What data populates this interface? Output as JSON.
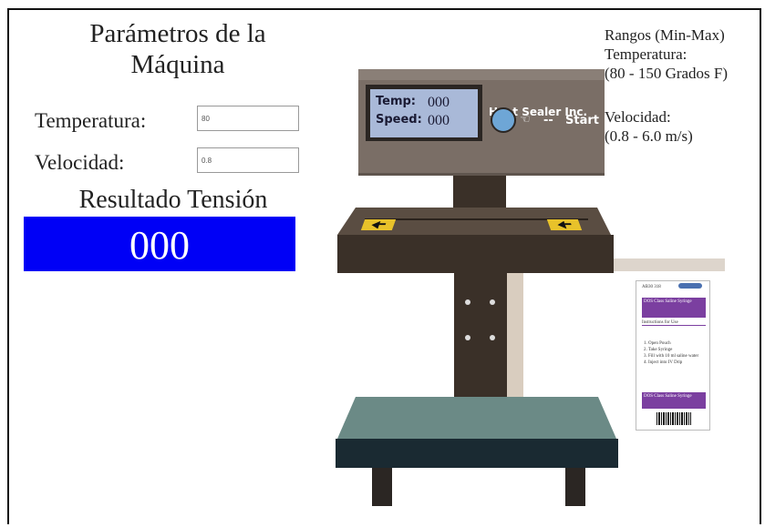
{
  "title": {
    "line1": "Parámetros de la",
    "line2": "Máquina"
  },
  "inputs": {
    "temperature_label": "Temperatura:",
    "temperature_value": "80",
    "speed_label": "Velocidad:",
    "speed_value": "0.8"
  },
  "result": {
    "title": "Resultado Tensión",
    "value": "000"
  },
  "ranges": {
    "heading": "Rangos (Min-Max)",
    "temp_label": "Temperatura:",
    "temp_range": "(80 - 150 Grados F)",
    "speed_label": "Velocidad:",
    "speed_range": "(0.8 - 6.0 m/s)"
  },
  "machine": {
    "brand": "Heat Sealer Inc.",
    "temp_label": "Temp:",
    "temp_value": "000",
    "speed_label": "Speed:",
    "speed_value": "000",
    "start_label": "Start"
  },
  "pouch": {
    "code": "AB30 318",
    "name": "DOS Class Saline Syringe",
    "instructions_title": "Instructions for Use",
    "steps": [
      "1. Open Pouch",
      "2. Take Syringe",
      "3. Fill with 10 ml saline water",
      "4. Inject into IV Drip"
    ],
    "footer": "DOS Class Saline Syringe"
  },
  "colors": {
    "result_bg": "#0000f6",
    "machine_body": "#7a6e66",
    "machine_dark": "#3a3028",
    "table_top": "#6b8a86",
    "table_front": "#1a2a32",
    "pouch_band": "#7b3fa0"
  }
}
